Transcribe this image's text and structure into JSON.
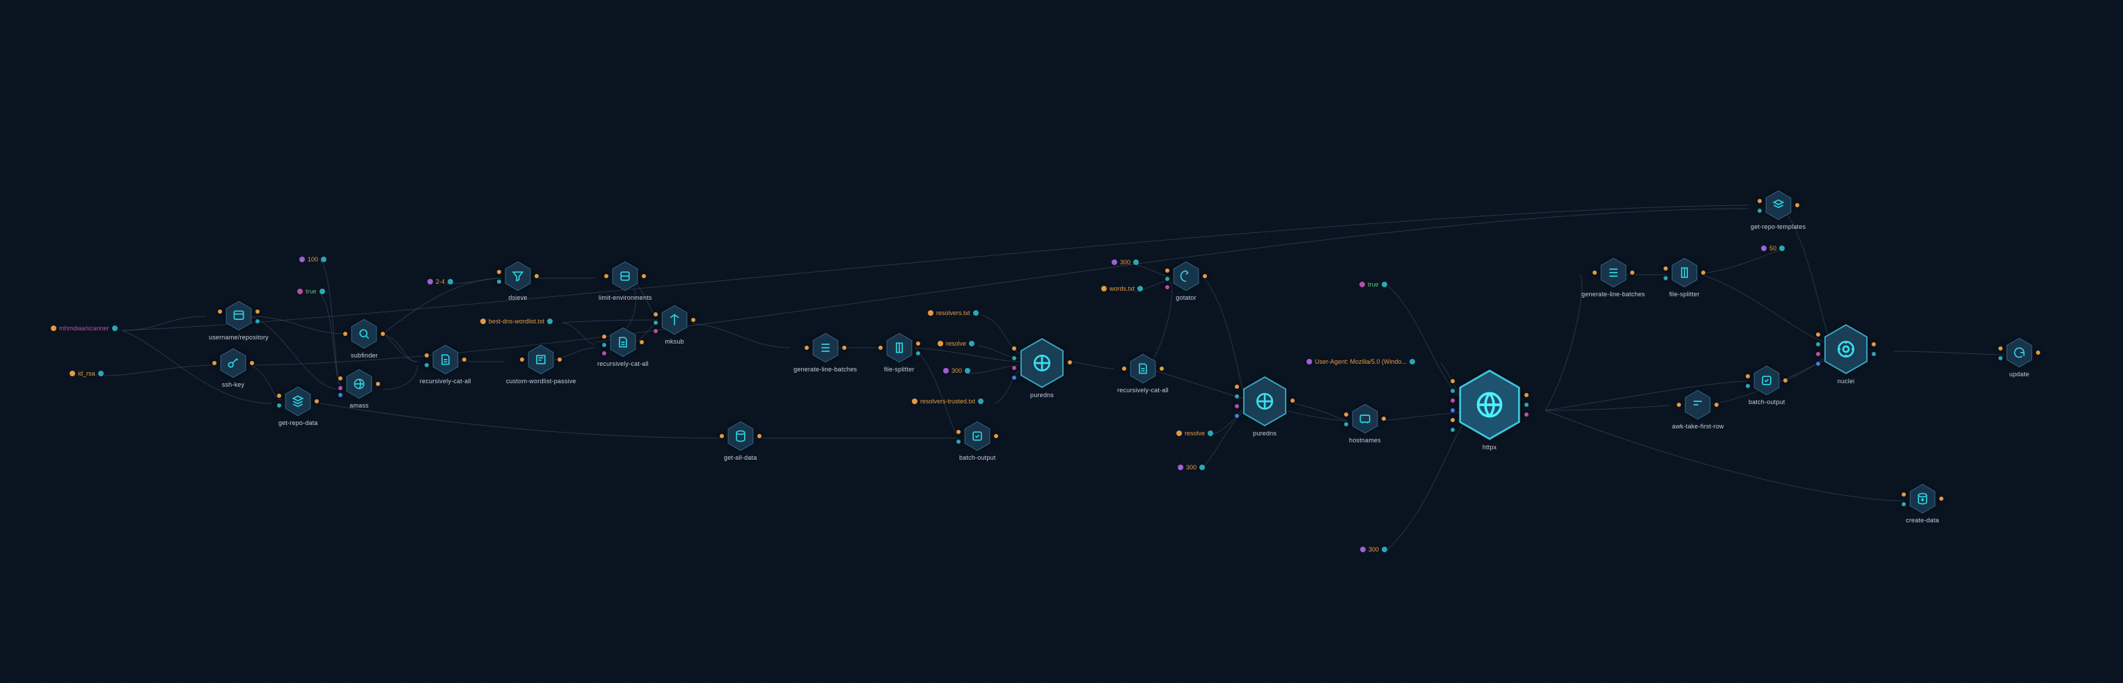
{
  "params": {
    "scanner": "mhmdiaa/scanner",
    "id_rsa": "id_rsa",
    "p100": "100",
    "ptrue1": "true",
    "p2_4": "2-4",
    "best_dns": "best-dns-wordlist.txt",
    "resolvers": "resolvers.txt",
    "resolve": "resolve",
    "resolvers_trusted": "resolvers-trusted.txt",
    "p300_1": "300",
    "p300_2": "300",
    "words": "words.txt",
    "p300_3": "300",
    "resolve2": "resolve",
    "ptrue2": "true",
    "ua": "User-Agent: Mozilla/5.0 (Windo...",
    "p300_4": "300",
    "p50": "50"
  },
  "nodes": {
    "user_repo": "username/repository",
    "ssh_key": "ssh-key",
    "get_repo_data": "get-repo-data",
    "subfinder": "subfinder",
    "amass": "amass",
    "dsieve": "dsieve",
    "limit_env": "limit-environments",
    "rec_cat_1": "recursively-cat-all",
    "custom_wordlist": "custom-wordlist-passive",
    "rec_cat_2": "recursively-cat-all",
    "mksub": "mksub",
    "get_all_data": "get-all-data",
    "gen_line_batches_1": "generate-line-batches",
    "file_splitter_1": "file-splitter",
    "batch_output_1": "batch-output",
    "puredns_1": "puredns",
    "rec_cat_3": "recursively-cat-all",
    "gotator": "gotator",
    "puredns_2": "puredns",
    "hostnames": "hostnames",
    "httpx": "httpx",
    "gen_line_batches_2": "generate-line-batches",
    "file_splitter_2": "file-splitter",
    "batch_output_2": "batch-output",
    "awk_first_row": "awk-take-first-row",
    "get_repo_templates": "get-repo-templates",
    "nuclei": "nuclei",
    "update": "update",
    "create_data": "create-data"
  }
}
